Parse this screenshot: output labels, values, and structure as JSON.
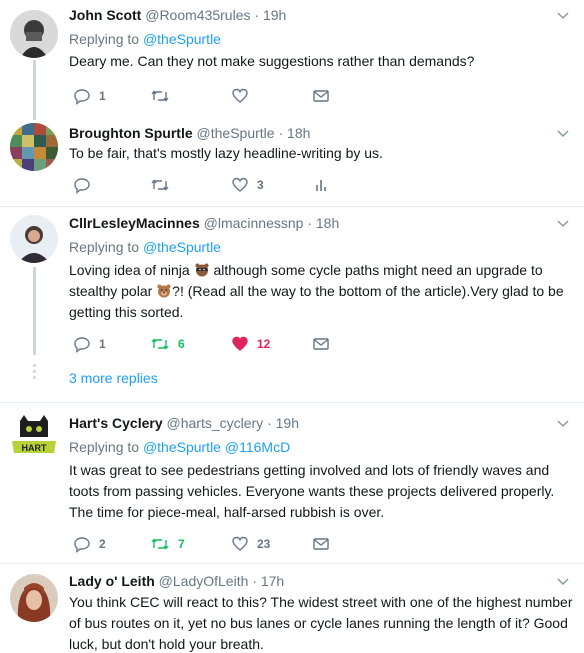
{
  "tweets": [
    {
      "name": "John Scott",
      "handle": "@Room435rules",
      "dot": "·",
      "time": "19h",
      "replying_prefix": "Replying to",
      "replying_to": "@theSpurtle",
      "replying_to_2": "",
      "body": "Deary me. Can they not make suggestions rather than demands?",
      "replies": "1",
      "retweets": "",
      "likes": ""
    },
    {
      "name": "Broughton Spurtle",
      "handle": "@theSpurtle",
      "dot": "·",
      "time": "18h",
      "body": "To be fair, that's mostly lazy headline-writing by us.",
      "replies": "",
      "retweets": "",
      "likes": "3"
    },
    {
      "name": "CllrLesleyMacinnes",
      "handle": "@lmacinnessnp",
      "dot": "·",
      "time": "18h",
      "replying_prefix": "Replying to",
      "replying_to": "@theSpurtle",
      "body_1": "Loving idea of ninja",
      "body_2": "although some cycle paths might need an upgrade to",
      "body_3": "stealthy polar",
      "body_4": "?! (Read all the way to the bottom of the article).Very glad to be",
      "body_5": "getting this sorted.",
      "replies": "1",
      "retweets": "6",
      "likes": "12"
    },
    {
      "name": "Hart's Cyclery",
      "handle": "@harts_cyclery",
      "dot": "·",
      "time": "19h",
      "replying_prefix": "Replying to",
      "replying_to": "@theSpurtle",
      "replying_to_2": "@116McD",
      "body": "It was great to see pedestrians getting involved and lots of friendly waves and toots from passing vehicles. Everyone wants these projects delivered properly. The time for piece-meal, half-arsed rubbish is over.",
      "replies": "2",
      "retweets": "7",
      "likes": "23"
    },
    {
      "name": "Lady o' Leith",
      "handle": "@LadyOfLeith",
      "dot": "·",
      "time": "17h",
      "body": "You think CEC will react to this? The widest street with one of the highest number of bus routes on it, yet no bus lanes or cycle lanes running the length of it? Good luck, but don't hold your breath."
    }
  ],
  "more_replies": "3 more replies",
  "icons": {
    "reply": "reply-icon",
    "retweet": "retweet-icon",
    "like": "heart-icon",
    "dm": "envelope-icon",
    "analytics": "analytics-icon",
    "menu": "chevron-down-icon",
    "ninja_emoji": "ninja-bear-emoji",
    "polar_emoji": "bear-emoji"
  },
  "colors": {
    "text": "#14171a",
    "muted": "#657786",
    "link": "#1da1f2",
    "retweet_green": "#17bf63",
    "like_red": "#e0245e",
    "thread_line": "#ccd6dd"
  }
}
